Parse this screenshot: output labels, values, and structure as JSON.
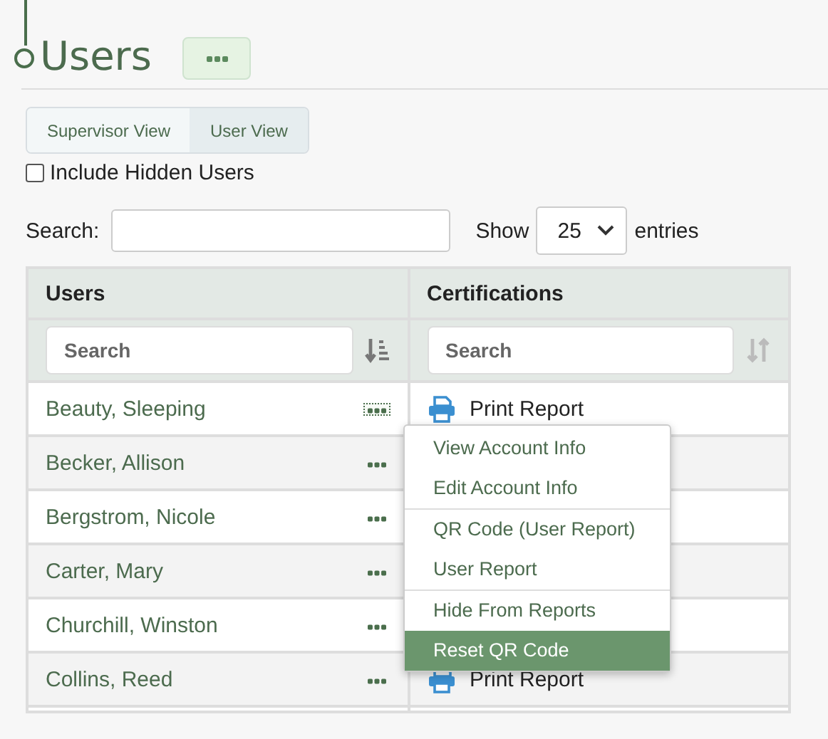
{
  "page": {
    "title": "Users"
  },
  "view_toggle": [
    {
      "label": "Supervisor View",
      "selected": false
    },
    {
      "label": "User View",
      "selected": true
    }
  ],
  "include_hidden": {
    "label": "Include Hidden Users",
    "checked": false
  },
  "search": {
    "label": "Search:"
  },
  "page_size": {
    "prefix": "Show",
    "value": "25",
    "suffix": "entries"
  },
  "table": {
    "columns": [
      {
        "label": "Users",
        "placeholder": "Search",
        "sorted": true
      },
      {
        "label": "Certifications",
        "placeholder": "Search",
        "sorted": false
      }
    ],
    "rows": [
      {
        "name": "Beauty, Sleeping",
        "menu_open": true,
        "certification": "Print Report"
      },
      {
        "name": "Becker, Allison",
        "menu_open": false
      },
      {
        "name": "Bergstrom, Nicole",
        "menu_open": false
      },
      {
        "name": "Carter, Mary",
        "menu_open": false
      },
      {
        "name": "Churchill, Winston",
        "menu_open": false
      },
      {
        "name": "Collins, Reed",
        "menu_open": false,
        "certification": "Print Report"
      }
    ]
  },
  "context_menu": {
    "groups": [
      [
        {
          "label": "View Account Info",
          "selected": false
        },
        {
          "label": "Edit Account Info",
          "selected": false
        }
      ],
      [
        {
          "label": "QR Code (User Report)",
          "selected": false
        },
        {
          "label": "User Report",
          "selected": false
        }
      ],
      [
        {
          "label": "Hide From Reports",
          "selected": false
        },
        {
          "label": "Reset QR Code",
          "selected": true
        }
      ]
    ]
  }
}
